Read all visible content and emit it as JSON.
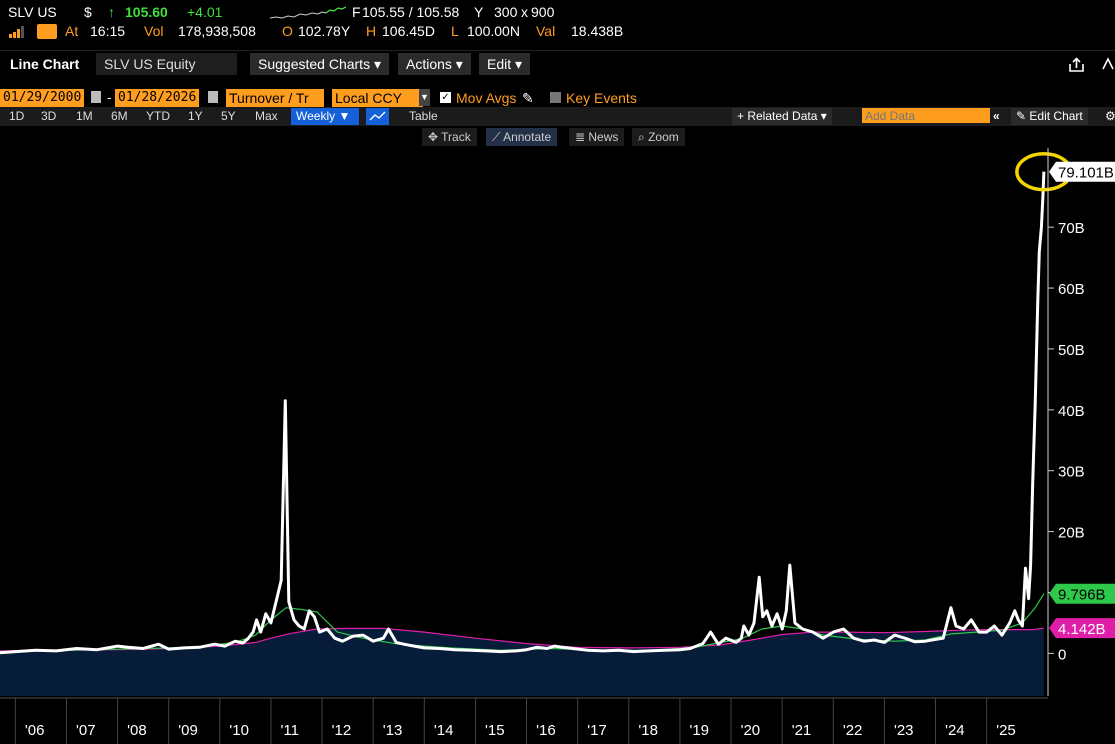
{
  "quote": {
    "ticker": "SLV US",
    "currency_symbol": "$",
    "up_arrow": "↑",
    "price": "105.60",
    "change": "+4.01",
    "bid_ask_label": "F",
    "bid_ask": "105.55 / 105.58",
    "bid_ask_suffix": "Y",
    "size_bid": "300",
    "size_x": "x",
    "size_ask": "900",
    "at_label": "At",
    "time": "16:15",
    "vol_label": "Vol",
    "volume": "178,938,508",
    "open_label": "O",
    "open": "102.78Y",
    "high_label": "H",
    "high": "106.45D",
    "low_label": "L",
    "low": "100.00N",
    "val_label": "Val",
    "val": "18.438B"
  },
  "toolbar": {
    "title": "Line Chart",
    "security": "SLV US Equity",
    "suggested": "Suggested Charts ▾",
    "actions": "Actions ▾",
    "edit": "Edit ▾"
  },
  "controls": {
    "start_date": "01/29/2000",
    "dash": "-",
    "end_date": "01/28/2026",
    "field": "Turnover / Tr",
    "currency": "Local CCY",
    "mov_avgs": "Mov Avgs",
    "key_events": "Key Events",
    "table": "Table",
    "related": "+ Related Data ▾",
    "add_data_placeholder": "Add Data",
    "edit_chart": "Edit Chart"
  },
  "ranges": [
    "1D",
    "3D",
    "1M",
    "6M",
    "YTD",
    "1Y",
    "5Y",
    "Max"
  ],
  "period": "Weekly ▼",
  "modes": [
    "Track",
    "Annotate",
    "News",
    "Zoom"
  ],
  "colors": {
    "accent_orange": "#ff9d1e",
    "price_green": "#3fe03f",
    "ma_short": "#2ec84a",
    "ma_long": "#e01fa8",
    "area_fill": "#071c38",
    "highlight_circle": "#f2d400"
  },
  "chart_data": {
    "type": "line",
    "title": "",
    "ylabel": "",
    "ylim": [
      -7000000000,
      83000000000
    ],
    "xlim": [
      2005.7,
      2026.2
    ],
    "y_ticks": [
      "0",
      "10B",
      "20B",
      "30B",
      "40B",
      "50B",
      "60B",
      "70B"
    ],
    "y_tick_values": [
      0,
      10000000000,
      20000000000,
      30000000000,
      40000000000,
      50000000000,
      60000000000,
      70000000000
    ],
    "x_ticks": [
      "'06",
      "'07",
      "'08",
      "'09",
      "'10",
      "'11",
      "'12",
      "'13",
      "'14",
      "'15",
      "'16",
      "'17",
      "'18",
      "'19",
      "'20",
      "'21",
      "'22",
      "'23",
      "'24",
      "'25"
    ],
    "last_value_labels": [
      {
        "label": "79.101B",
        "value": 79100000000,
        "series": "turnover"
      },
      {
        "label": "9.796B",
        "value": 9796000000,
        "series": "ma_short"
      },
      {
        "label": "4.142B",
        "value": 4142000000,
        "series": "ma_long"
      }
    ],
    "series": [
      {
        "key": "turnover",
        "x": [
          2005.7,
          2006.0,
          2006.4,
          2006.8,
          2007.2,
          2007.6,
          2008.0,
          2008.2,
          2008.5,
          2008.8,
          2009.0,
          2009.3,
          2009.6,
          2009.9,
          2010.1,
          2010.3,
          2010.45,
          2010.55,
          2010.65,
          2010.72,
          2010.8,
          2010.9,
          2011.0,
          2011.1,
          2011.2,
          2011.28,
          2011.35,
          2011.45,
          2011.55,
          2011.65,
          2011.75,
          2011.85,
          2011.95,
          2012.1,
          2012.25,
          2012.4,
          2012.6,
          2012.8,
          2013.0,
          2013.2,
          2013.3,
          2013.45,
          2013.6,
          2013.8,
          2014.0,
          2014.3,
          2014.6,
          2014.9,
          2015.2,
          2015.5,
          2015.8,
          2016.0,
          2016.2,
          2016.4,
          2016.55,
          2016.7,
          2016.9,
          2017.2,
          2017.5,
          2017.8,
          2018.1,
          2018.4,
          2018.7,
          2019.0,
          2019.2,
          2019.45,
          2019.6,
          2019.75,
          2019.9,
          2020.1,
          2020.2,
          2020.25,
          2020.35,
          2020.45,
          2020.55,
          2020.62,
          2020.7,
          2020.8,
          2020.9,
          2021.0,
          2021.08,
          2021.15,
          2021.25,
          2021.4,
          2021.6,
          2021.8,
          2022.0,
          2022.2,
          2022.4,
          2022.6,
          2022.8,
          2023.0,
          2023.2,
          2023.4,
          2023.6,
          2023.8,
          2024.0,
          2024.15,
          2024.3,
          2024.4,
          2024.55,
          2024.7,
          2024.85,
          2025.0,
          2025.15,
          2025.3,
          2025.45,
          2025.55,
          2025.62,
          2025.7,
          2025.76,
          2025.82,
          2025.86,
          2025.9,
          2025.95,
          2026.0,
          2026.03,
          2026.07,
          2026.1,
          2026.12
        ],
        "values": [
          100000000.0,
          300000000.0,
          500000000.0,
          400000000.0,
          800000000.0,
          600000000.0,
          1200000000.0,
          1000000000.0,
          800000000.0,
          1500000000.0,
          700000000.0,
          900000000.0,
          1000000000.0,
          1500000000.0,
          1200000000.0,
          2000000000.0,
          1700000000.0,
          2400000000.0,
          3500000000.0,
          5500000000.0,
          3500000000.0,
          6500000000.0,
          5000000000.0,
          8500000000.0,
          12000000000.0,
          41500000000.0,
          8500000000.0,
          5500000000.0,
          4500000000.0,
          4000000000.0,
          7000000000.0,
          6000000000.0,
          3500000000.0,
          4000000000.0,
          2500000000.0,
          2000000000.0,
          2800000000.0,
          3000000000.0,
          2000000000.0,
          2500000000.0,
          4000000000.0,
          1800000000.0,
          1500000000.0,
          1200000000.0,
          900000000.0,
          800000000.0,
          600000000.0,
          500000000.0,
          400000000.0,
          300000000.0,
          400000000.0,
          600000000.0,
          1000000000.0,
          800000000.0,
          1200000000.0,
          1000000000.0,
          800000000.0,
          500000000.0,
          400000000.0,
          500000000.0,
          300000000.0,
          400000000.0,
          500000000.0,
          600000000.0,
          800000000.0,
          1600000000.0,
          3500000000.0,
          1500000000.0,
          2500000000.0,
          1800000000.0,
          2500000000.0,
          4500000000.0,
          3000000000.0,
          5000000000.0,
          12500000000.0,
          6000000000.0,
          7000000000.0,
          4500000000.0,
          6500000000.0,
          4000000000.0,
          7000000000.0,
          14500000000.0,
          5000000000.0,
          4000000000.0,
          3500000000.0,
          2500000000.0,
          3500000000.0,
          4000000000.0,
          2500000000.0,
          2000000000.0,
          2200000000.0,
          1800000000.0,
          3000000000.0,
          2500000000.0,
          1900000000.0,
          2000000000.0,
          2300000000.0,
          2500000000.0,
          7500000000.0,
          4500000000.0,
          4000000000.0,
          5500000000.0,
          3500000000.0,
          3500000000.0,
          4500000000.0,
          3000000000.0,
          5000000000.0,
          7000000000.0,
          5500000000.0,
          4500000000.0,
          14000000000.0,
          9000000000.0,
          14500000000.0,
          28000000000.0,
          41000000000.0,
          58000000000.0,
          66000000000.0,
          70000000000.0,
          75000000000.0,
          79100000000.0
        ]
      },
      {
        "key": "ma_short",
        "x": [
          2005.7,
          2007.0,
          2008.5,
          2009.5,
          2010.3,
          2010.7,
          2011.0,
          2011.3,
          2011.6,
          2011.9,
          2012.3,
          2012.8,
          2013.5,
          2014.5,
          2015.5,
          2016.5,
          2017.5,
          2018.5,
          2019.3,
          2019.8,
          2020.2,
          2020.6,
          2021.0,
          2021.4,
          2021.8,
          2022.5,
          2023.2,
          2023.8,
          2024.3,
          2024.8,
          2025.3,
          2025.7,
          2025.95,
          2026.12
        ],
        "values": [
          300000000.0,
          500000000.0,
          800000000.0,
          1000000000.0,
          1800000000.0,
          3000000000.0,
          5500000000.0,
          7500000000.0,
          7200000000.0,
          6800000000.0,
          3500000000.0,
          2500000000.0,
          1500000000.0,
          900000000.0,
          500000000.0,
          800000000.0,
          500000000.0,
          500000000.0,
          1000000000.0,
          1800000000.0,
          2400000000.0,
          4000000000.0,
          4500000000.0,
          4000000000.0,
          3000000000.0,
          2300000000.0,
          2000000000.0,
          2200000000.0,
          3200000000.0,
          3500000000.0,
          3800000000.0,
          5000000000.0,
          7500000000.0,
          9796000000.0
        ]
      },
      {
        "key": "ma_long",
        "x": [
          2005.7,
          2007.0,
          2008.0,
          2009.0,
          2010.0,
          2010.7,
          2011.0,
          2011.4,
          2011.9,
          2012.5,
          2013.2,
          2014.0,
          2015.0,
          2016.0,
          2017.0,
          2018.0,
          2019.0,
          2019.8,
          2020.4,
          2021.0,
          2021.6,
          2022.2,
          2023.0,
          2023.8,
          2024.5,
          2025.0,
          2025.5,
          2025.9,
          2026.12
        ],
        "values": [
          400000000.0,
          500000000.0,
          600000000.0,
          800000000.0,
          1200000000.0,
          1800000000.0,
          2500000000.0,
          3300000000.0,
          4000000000.0,
          4100000000.0,
          4100000000.0,
          3500000000.0,
          2500000000.0,
          1600000000.0,
          1000000000.0,
          900000000.0,
          1000000000.0,
          1400000000.0,
          2200000000.0,
          3100000000.0,
          3500000000.0,
          3500000000.0,
          3400000000.0,
          3600000000.0,
          3800000000.0,
          3900000000.0,
          3900000000.0,
          3900000000.0,
          4142000000.0
        ]
      }
    ],
    "grid": false,
    "legend": "none"
  }
}
